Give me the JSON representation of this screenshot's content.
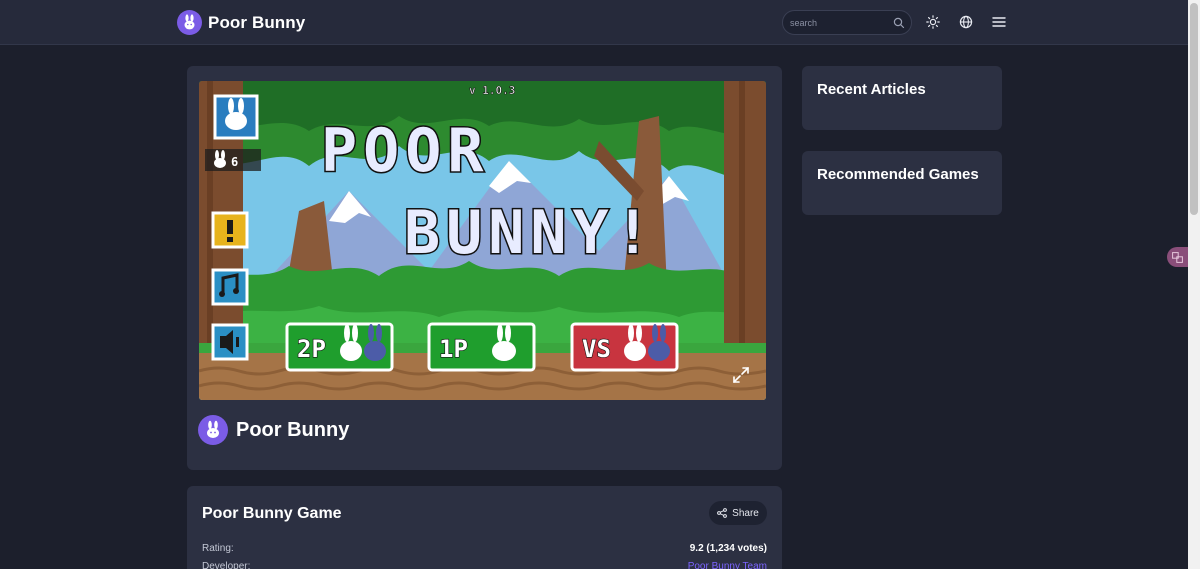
{
  "header": {
    "brand_name": "Poor Bunny",
    "search_placeholder": "search",
    "icons": [
      "bunny-logo-icon",
      "search-icon",
      "sun-icon",
      "globe-icon",
      "menu-icon"
    ]
  },
  "game": {
    "title": "Poor Bunny",
    "screen": {
      "version": "v 1.0.3",
      "logo_line1": "POOR",
      "logo_line2": "BUNNY!",
      "lives": "6",
      "modes": [
        "2P",
        "1P",
        "VS"
      ]
    }
  },
  "info": {
    "title": "Poor Bunny Game",
    "share_label": "Share",
    "rows": [
      {
        "label": "Rating:",
        "value": "9.2 (1,234 votes)"
      },
      {
        "label": "Developer:",
        "value": "Poor Bunny Team"
      }
    ]
  },
  "sidebar": {
    "recent_articles": "Recent Articles",
    "recommended_games": "Recommended Games"
  },
  "colors": {
    "background": "#1c1f2c",
    "header": "#262a3b",
    "card": "#2c3042",
    "accent": "#7b5ce6",
    "link": "#7b64ff"
  }
}
